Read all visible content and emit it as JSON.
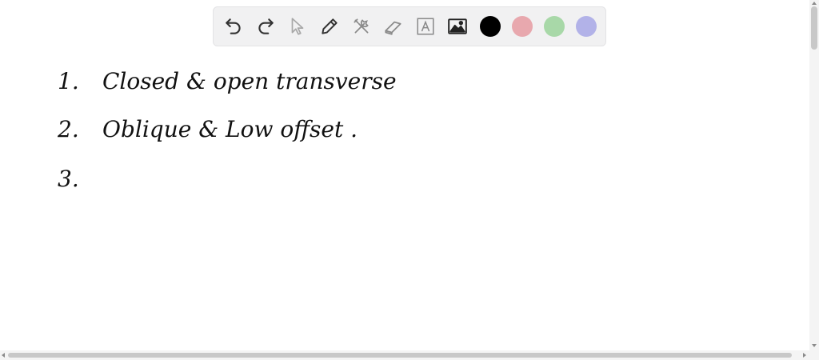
{
  "toolbar": {
    "tools": [
      {
        "name": "undo-icon",
        "label": "Undo"
      },
      {
        "name": "redo-icon",
        "label": "Redo"
      },
      {
        "name": "pointer-icon",
        "label": "Select"
      },
      {
        "name": "pencil-icon",
        "label": "Pen"
      },
      {
        "name": "tools-icon",
        "label": "Tools"
      },
      {
        "name": "eraser-icon",
        "label": "Eraser"
      },
      {
        "name": "text-icon",
        "label": "Text"
      },
      {
        "name": "image-icon",
        "label": "Image"
      }
    ],
    "colors": [
      {
        "name": "black",
        "hex": "#000000"
      },
      {
        "name": "pink",
        "hex": "#e8a8ae"
      },
      {
        "name": "green",
        "hex": "#a8d8a8"
      },
      {
        "name": "lavender",
        "hex": "#b2b2e8"
      }
    ]
  },
  "notes": [
    {
      "number": "1.",
      "text": "Closed & open transverse"
    },
    {
      "number": "2.",
      "text": "Oblique & Low offset ."
    },
    {
      "number": "3.",
      "text": ""
    }
  ]
}
